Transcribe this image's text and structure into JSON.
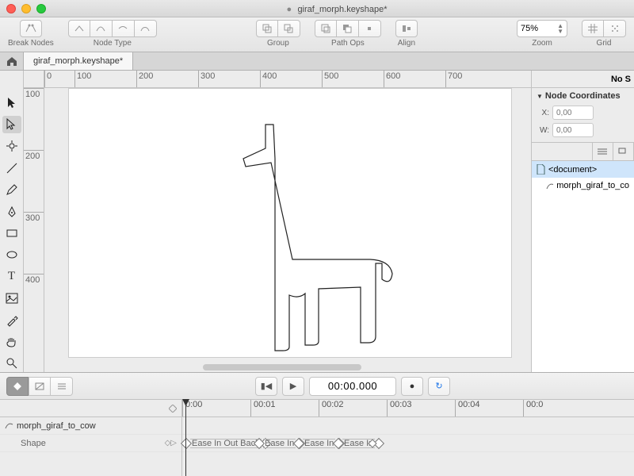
{
  "window": {
    "title": "giraf_morph.keyshape*",
    "modified_indicator": "●"
  },
  "toolbar": {
    "break_nodes": "Break Nodes",
    "node_type": "Node Type",
    "group": "Group",
    "path_ops": "Path Ops",
    "align": "Align",
    "zoom_label": "Zoom",
    "zoom_value": "75%",
    "grid_label": "Grid"
  },
  "tabs": {
    "active": "giraf_morph.keyshape*"
  },
  "rulers": {
    "h": [
      "0",
      "100",
      "200",
      "300",
      "400",
      "500",
      "600",
      "700"
    ],
    "v": [
      "100",
      "200",
      "300",
      "400"
    ]
  },
  "right_panel": {
    "status": "No S",
    "section": "Node Coordinates",
    "x_label": "X:",
    "w_label": "W:",
    "x_placeholder": "0,00",
    "w_placeholder": "0,00",
    "tree": {
      "root": "<document>",
      "child": "morph_giraf_to_co"
    }
  },
  "timeline": {
    "time_display": "00:00.000",
    "ruler": [
      "0:00",
      "00:01",
      "00:02",
      "00:03",
      "00:04",
      "00:0"
    ],
    "object_name": "morph_giraf_to_cow",
    "property": "Shape",
    "segments": [
      "Ease In Out Back",
      "Ease In",
      "Ease In",
      "Ease In"
    ]
  }
}
